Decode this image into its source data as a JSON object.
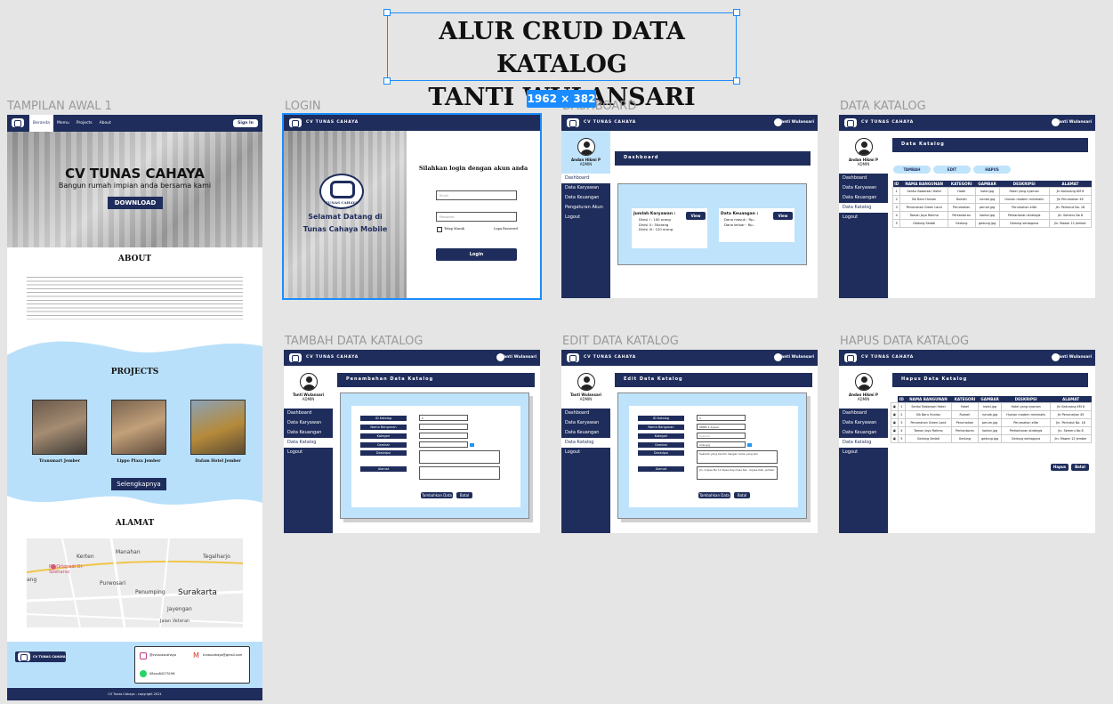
{
  "title_line1": "ALUR CRUD DATA KATALOG",
  "title_line2": "TANTI WULANSARI",
  "dimension_badge": "1962 × 382",
  "frames": {
    "awal": "TAMPILAN AWAL 1",
    "login": "LOGIN",
    "dashboard": "DASHBOARD",
    "katalog": "DATA KATALOG",
    "tambah": "TAMBAH DATA KATALOG",
    "edit": "EDIT DATA KATALOG",
    "hapus": "HAPUS DATA KATALOG"
  },
  "landing": {
    "nav": [
      "Beranda",
      "Memu",
      "Projects",
      "About"
    ],
    "signin": "Sign In",
    "hero_title": "CV TUNAS CAHAYA",
    "hero_sub": "Bangun rumah impian anda bersama kami",
    "download": "DOWNLOAD",
    "about": "ABOUT",
    "projects": "PROJECTS",
    "project_items": [
      "Transmart Jember",
      "Lippo Plaza Jember",
      "Dafam Hotel Jember"
    ],
    "more": "Selengkapnya",
    "alamat": "ALAMAT",
    "map_labels": [
      "Kerten",
      "Manahan",
      "Tegalharjo",
      "RS Ortopedi Dr. Soeharso",
      "Purwosari",
      "Penumping",
      "Surakarta",
      "Jayengan",
      "Jalan Veteran",
      "ang"
    ],
    "footer_brand": "CV TUNAS CAHAYA",
    "ig": "@cvtunascahaya",
    "mail": "tunascahaya@gmail.com",
    "wa": "08xxx84275196",
    "copy": "CV Tunas Cahaya - copyright 2021"
  },
  "login": {
    "brand": "CV TUNAS CAHAYA",
    "welcome1": "Selamat Datang di",
    "welcome2": "Tunas Cahaya Mobile",
    "logo_text": "TUNAS CAHAYA",
    "prompt": "Silahkan login dengan akun anda",
    "email_ph": "Email",
    "pass_ph": "Password",
    "remember": "Tetap Masuk",
    "forgot": "Lupa Password",
    "btn": "Login"
  },
  "app": {
    "brand": "CV TUNAS CAHAYA",
    "user": "Tanti Wulansari",
    "admin_name": "Andan Hikmi P",
    "admin_role": "ADMIN",
    "menu_dash": [
      "Dashboard",
      "Data Karyawan",
      "Data Keuangan",
      "Pengaturan Akun",
      "Logout"
    ],
    "menu_kat": [
      "Dashboard",
      "Data Karyawan",
      "Data Keuangan",
      "Data Katalog",
      "Logout"
    ]
  },
  "dashboard": {
    "banner": "Dashboard",
    "k_title": "Jumlah Karyawan :",
    "k_lines": [
      "Divisi I : 100 orang",
      "Divisi II : 50orang",
      "Divisi III : 120 orang"
    ],
    "u_title": "Data Keuangan :",
    "u_lines": [
      "Dana masuk : Rp.-",
      "Dana keluar : Rp.-"
    ],
    "view": "View"
  },
  "katalog": {
    "banner": "Data Katalog",
    "actions": [
      "TAMBAH",
      "EDIT",
      "HAPUS"
    ],
    "headers": [
      "ID",
      "NAMA BANGUNAN",
      "KATEGORI",
      "GAMBAR",
      "DESKRIPSI",
      "ALAMAT"
    ],
    "rows": [
      [
        "1",
        "Sentul Babarsari Hotel",
        "Hotel",
        "hotel.jpg",
        "Hotel yang nyaman",
        "Jln Kaliurang KM 6"
      ],
      [
        "2",
        "Sik Baru Hunian",
        "Rumah",
        "rumah.jpg",
        "Hunian modern minimalis",
        "Jln Perumahan 45"
      ],
      [
        "3",
        "Perumahan Green Land",
        "Perumahan",
        "perum.jpg",
        "Perumahan elite",
        "Jln. Perkutut No. 18"
      ],
      [
        "4",
        "Taman Joyo Rahmo",
        "Perkantoran",
        "kantor.jpg",
        "Perkantoran strategis",
        "Jln. Semeru No 8"
      ],
      [
        "5",
        "Gedung Sedati",
        "Gedung",
        "gedung.jpg",
        "Gedung serbaguna",
        "Jln. Mawar 12 Jember"
      ]
    ]
  },
  "tambah": {
    "banner": "Penambahan Data Katalog"
  },
  "editp": {
    "banner": "Edit Data Katalog",
    "values": [
      "3",
      "SMPN 2 Arjasa",
      "Sekolah",
      "smp.jpg",
      "Sekolah yang berdiri dengan lama yang kini",
      "Jln. Arjasa No 12 Desa Kayumas Kec. Arjasa Kab. Jember"
    ]
  },
  "form_labels": [
    "ID Katalog",
    "Nama Bangunan",
    "Kategori",
    "Gambar",
    "Deskripsi",
    "Alamat"
  ],
  "form_buttons": [
    "Tambahkan Data",
    "Batal"
  ],
  "edit_buttons": [
    "Tambahkan Data",
    "Batal"
  ],
  "hapus": {
    "banner": "Hapus Data Katalog",
    "buttons": [
      "Hapus",
      "Batal"
    ]
  }
}
